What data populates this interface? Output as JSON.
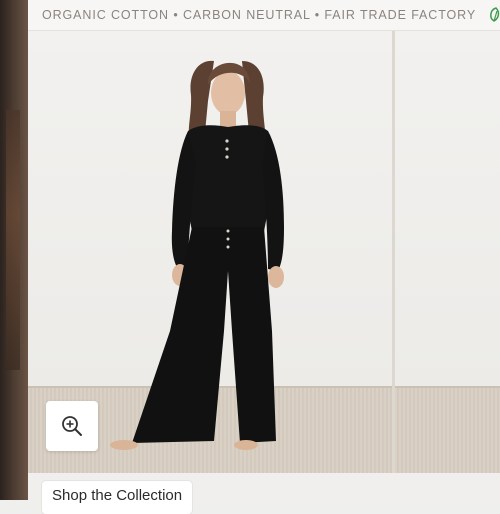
{
  "banner": {
    "text": "ORGANIC COTTON • CARBON NEUTRAL • FAIR TRADE FACTORY",
    "leaf_icon": "leaf-icon"
  },
  "gallery": {
    "zoom_icon": "zoom-in-icon",
    "cta_label": "Shop the Collection"
  },
  "colors": {
    "garment": "#121212",
    "banner_text": "#8a8480",
    "leaf": "#3f9a4b"
  }
}
